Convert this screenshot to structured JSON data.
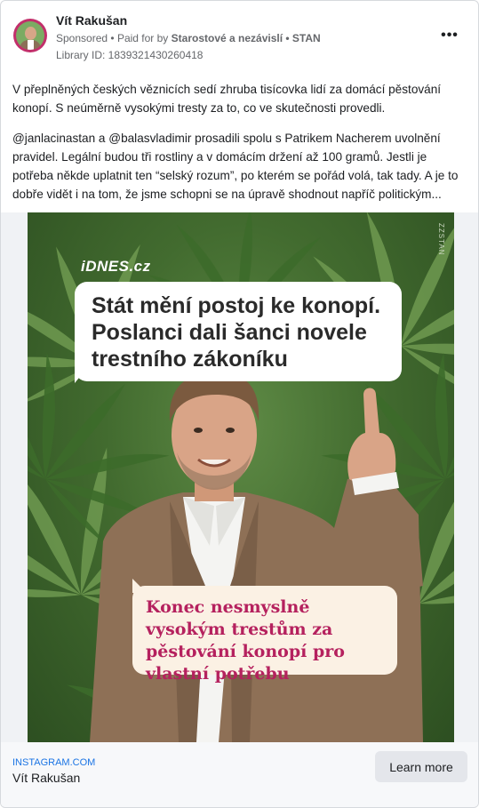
{
  "post": {
    "author": "Vít Rakušan",
    "sponsored_label": "Sponsored",
    "separator": "•",
    "paid_for_by_prefix": "Paid for by",
    "sponsor_name": "Starostové a nezávislí • STAN",
    "library_id": "Library ID: 1839321430260418",
    "more_icon": "more-horizontal-icon",
    "paragraphs": [
      "V přeplněných českých věznicích sedí zhruba tisícovka lidí za domácí pěstování konopí. S neúměrně vysokými tresty za to, co ve skutečnosti provedli.",
      "@janlacinastan a @balasvladimir prosadili spolu s Patrikem Nacherem uvolnění pravidel. Legální budou tři rostliny a v domácím držení až 100 gramů. Jestli je potřeba někde uplatnit ten “selský rozum”, po kterém se pořád volá, tak tady. A je to dobře vidět i na tom, že jsme schopni se na úpravě shodnout napříč politickým..."
    ]
  },
  "creative": {
    "brand": "iDNES.cz",
    "watermark": "ZZSTAN",
    "headline": "Stát mění postoj ke konopí. Poslanci dali šanci novele trestního zákoníku",
    "quote": "Konec nesmyslně vysokým trestům za pěstování konopí pro vlastní potřebu",
    "colors": {
      "leaf_dark": "#2f5823",
      "leaf_light": "#6f9a51",
      "quote_text": "#b5215e",
      "quote_bubble": "#fbf1e4"
    }
  },
  "footer": {
    "domain": "INSTAGRAM.COM",
    "name": "Vít Rakušan",
    "cta": "Learn more"
  }
}
